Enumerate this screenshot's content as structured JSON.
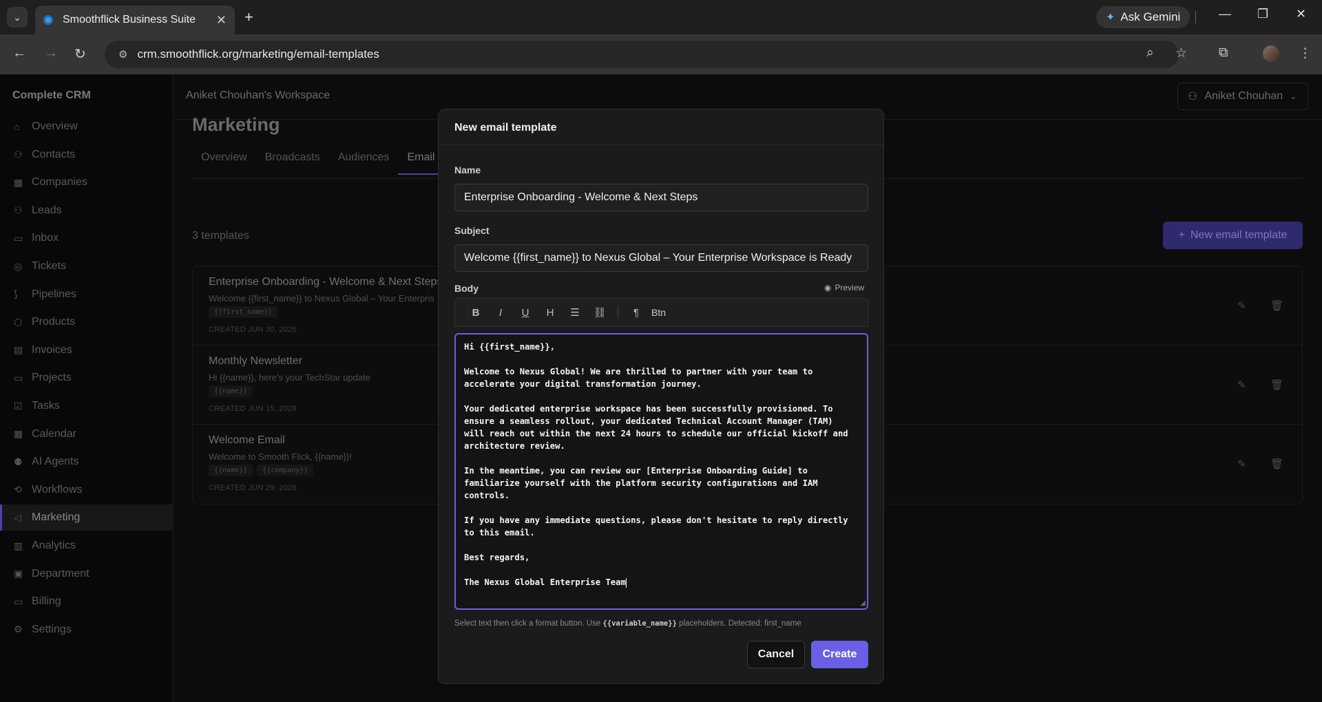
{
  "browser": {
    "tab_title": "Smoothflick Business Suite",
    "gemini_label": "Ask Gemini",
    "url": "crm.smoothflick.org/marketing/email-templates"
  },
  "sidebar": {
    "brand": "Complete CRM",
    "items": [
      {
        "label": "Overview",
        "icon": "home-icon"
      },
      {
        "label": "Contacts",
        "icon": "user-icon"
      },
      {
        "label": "Companies",
        "icon": "building-icon"
      },
      {
        "label": "Leads",
        "icon": "user-plus-icon"
      },
      {
        "label": "Inbox",
        "icon": "chat-icon"
      },
      {
        "label": "Tickets",
        "icon": "lifebuoy-icon"
      },
      {
        "label": "Pipelines",
        "icon": "pipeline-icon"
      },
      {
        "label": "Products",
        "icon": "box-icon"
      },
      {
        "label": "Invoices",
        "icon": "invoice-icon"
      },
      {
        "label": "Projects",
        "icon": "folder-icon"
      },
      {
        "label": "Tasks",
        "icon": "check-square-icon"
      },
      {
        "label": "Calendar",
        "icon": "calendar-icon"
      },
      {
        "label": "AI Agents",
        "icon": "bot-icon"
      },
      {
        "label": "Workflows",
        "icon": "workflow-icon"
      },
      {
        "label": "Marketing",
        "icon": "megaphone-icon"
      },
      {
        "label": "Analytics",
        "icon": "bar-chart-icon"
      },
      {
        "label": "Department",
        "icon": "org-icon"
      },
      {
        "label": "Billing",
        "icon": "card-icon"
      },
      {
        "label": "Settings",
        "icon": "gear-icon"
      }
    ],
    "active_index": 14
  },
  "header": {
    "workspace": "Aniket Chouhan's Workspace",
    "user": "Aniket Chouhan"
  },
  "page": {
    "title": "Marketing",
    "tabs": [
      "Overview",
      "Broadcasts",
      "Audiences",
      "Email"
    ],
    "active_tab": 3,
    "count": "3 templates",
    "new_button": "New email template"
  },
  "templates": [
    {
      "title": "Enterprise Onboarding - Welcome & Next Steps",
      "subtitle": "Welcome {{first_name}} to Nexus Global – Your Enterpris",
      "tags": [
        "{{first_name}}"
      ],
      "date": "CREATED JUN 30, 2026"
    },
    {
      "title": "Monthly Newsletter",
      "subtitle": "Hi {{name}}, here's your TechStar update",
      "tags": [
        "{{name}}"
      ],
      "date": "CREATED JUN 15, 2026"
    },
    {
      "title": "Welcome Email",
      "subtitle": "Welcome to Smooth Flick, {{name}}!",
      "tags": [
        "{{name}}",
        "{{company}}"
      ],
      "date": "CREATED JUN 29, 2026"
    }
  ],
  "modal": {
    "title": "New email template",
    "name_label": "Name",
    "name_value": "Enterprise Onboarding - Welcome & Next Steps",
    "subject_label": "Subject",
    "subject_value": "Welcome {{first_name}} to Nexus Global – Your Enterprise Workspace is Ready",
    "body_label": "Body",
    "preview_label": "Preview",
    "toolbar": {
      "btn_label": "Btn"
    },
    "body_lines": [
      "Hi {{first_name}},",
      "",
      "Welcome to Nexus Global! We are thrilled to partner with your team to",
      "accelerate your digital transformation journey.",
      "",
      "Your dedicated enterprise workspace has been successfully provisioned. To",
      "ensure a seamless rollout, your dedicated Technical Account Manager (TAM)",
      "will reach out within the next 24 hours to schedule our official kickoff and",
      "architecture review.",
      "",
      "In the meantime, you can review our [Enterprise Onboarding Guide] to",
      "familiarize yourself with the platform security configurations and IAM",
      "controls.",
      "",
      "If you have any immediate questions, please don't hesitate to reply directly",
      "to this email.",
      "",
      "Best regards,",
      "",
      "The Nexus Global Enterprise Team"
    ],
    "hint_before": "Select text then click a format button. Use",
    "hint_code": "{{variable_name}}",
    "hint_after": "placeholders. Detected: first_name",
    "cancel_label": "Cancel",
    "create_label": "Create"
  }
}
